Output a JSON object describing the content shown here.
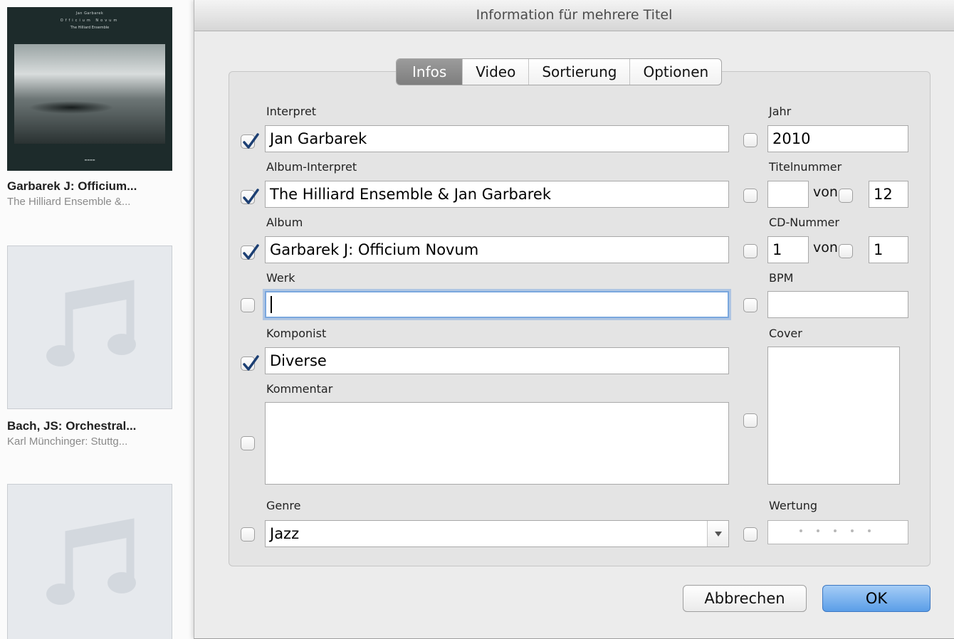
{
  "sidebar": {
    "albums": [
      {
        "title": "Garbarek J: Officium...",
        "artist": "The Hilliard Ensemble &...",
        "cover_lines": [
          "Jan Garbarek",
          "Officium Novum",
          "The Hilliard Ensemble"
        ]
      },
      {
        "title": "Bach, JS: Orchestral...",
        "artist": "Karl Münchinger: Stuttg..."
      },
      {}
    ]
  },
  "dialog": {
    "title": "Information für mehrere Titel",
    "tabs": [
      {
        "label": "Infos",
        "active": true
      },
      {
        "label": "Video",
        "active": false
      },
      {
        "label": "Sortierung",
        "active": false
      },
      {
        "label": "Optionen",
        "active": false
      }
    ],
    "fields": {
      "interpret": {
        "label": "Interpret",
        "value": "Jan Garbarek",
        "checked": true
      },
      "album_interpret": {
        "label": "Album-Interpret",
        "value": "The Hilliard Ensemble & Jan Garbarek",
        "checked": true
      },
      "album": {
        "label": "Album",
        "value": "Garbarek J: Officium Novum",
        "checked": true
      },
      "werk": {
        "label": "Werk",
        "value": "",
        "checked": false
      },
      "komponist": {
        "label": "Komponist",
        "value": "Diverse",
        "checked": true
      },
      "kommentar": {
        "label": "Kommentar",
        "value": "",
        "checked": false
      },
      "genre": {
        "label": "Genre",
        "value": "Jazz",
        "checked": false
      },
      "jahr": {
        "label": "Jahr",
        "value": "2010",
        "checked": false
      },
      "titelnummer": {
        "label": "Titelnummer",
        "value": "",
        "von_label": "von",
        "total": "12",
        "checked": false,
        "total_checked": false
      },
      "cd_nummer": {
        "label": "CD-Nummer",
        "value": "1",
        "von_label": "von",
        "total": "1",
        "checked": false,
        "total_checked": false
      },
      "bpm": {
        "label": "BPM",
        "value": "",
        "checked": false
      },
      "cover": {
        "label": "Cover",
        "checked": false
      },
      "wertung": {
        "label": "Wertung",
        "rating": 0,
        "max": 5,
        "checked": false
      }
    },
    "buttons": {
      "cancel": "Abbrechen",
      "ok": "OK"
    }
  },
  "colors": {
    "checkmark": "#1c3f73",
    "focus_ring": "#7aa7de",
    "ok_button": "#5b9ee8",
    "active_tab": "#8a8a8a"
  }
}
